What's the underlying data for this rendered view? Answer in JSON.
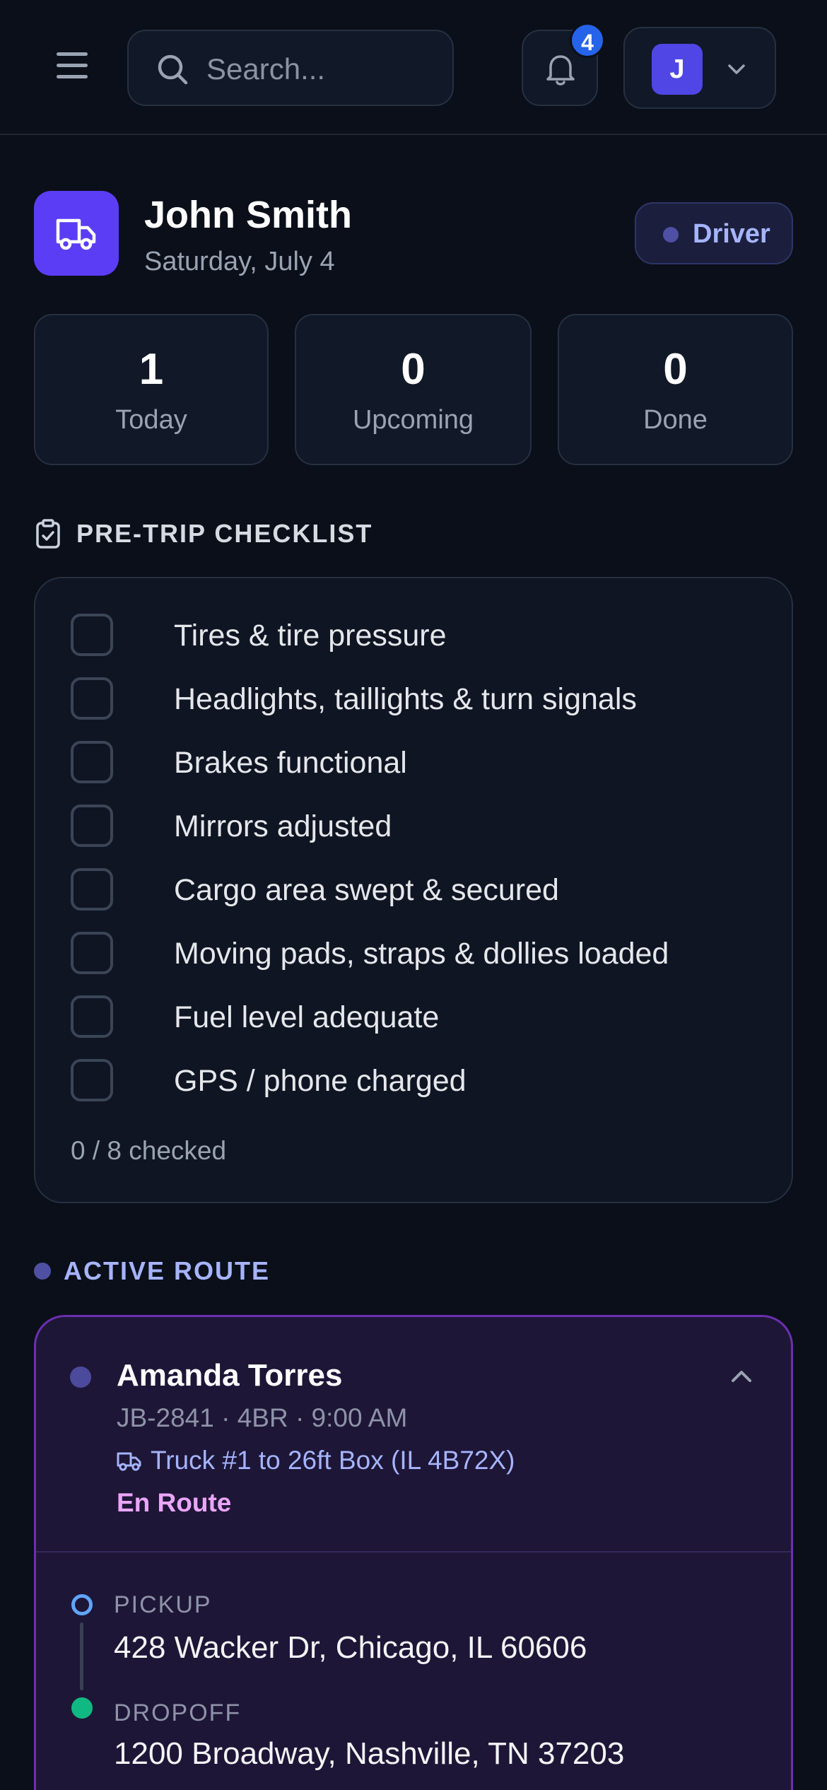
{
  "header": {
    "search_placeholder": "Search...",
    "notification_count": "4",
    "avatar_initial": "J"
  },
  "driver": {
    "name": "John Smith",
    "date": "Saturday, July 4",
    "role": "Driver"
  },
  "stats": [
    {
      "value": "1",
      "label": "Today"
    },
    {
      "value": "0",
      "label": "Upcoming"
    },
    {
      "value": "0",
      "label": "Done"
    }
  ],
  "checklist": {
    "title": "PRE-TRIP CHECKLIST",
    "items": [
      {
        "label": "Tires & tire pressure",
        "checked": false
      },
      {
        "label": "Headlights, taillights & turn signals",
        "checked": false
      },
      {
        "label": "Brakes functional",
        "checked": false
      },
      {
        "label": "Mirrors adjusted",
        "checked": false
      },
      {
        "label": "Cargo area swept & secured",
        "checked": false
      },
      {
        "label": "Moving pads, straps & dollies loaded",
        "checked": false
      },
      {
        "label": "Fuel level adequate",
        "checked": false
      },
      {
        "label": "GPS / phone charged",
        "checked": false
      }
    ],
    "progress": "0 / 8 checked"
  },
  "active_route": {
    "title": "ACTIVE ROUTE",
    "customer": "Amanda Torres",
    "meta": "JB-2841 · 4BR · 9:00 AM",
    "truck": "Truck #1 to 26ft Box (IL 4B72X)",
    "status": "En Route",
    "pickup_label": "PICKUP",
    "pickup_address": "428 Wacker Dr, Chicago, IL 60606",
    "dropoff_label": "DROPOFF",
    "dropoff_address": "1200 Broadway, Nashville, TN 37203"
  },
  "colors": {
    "background": "#0b0f19",
    "accent": "#5b3df5",
    "badge": "#2563eb",
    "route_border": "#6b2fb0",
    "status": "#e9a6f7",
    "pickup": "#60a5fa",
    "dropoff": "#10b981"
  }
}
